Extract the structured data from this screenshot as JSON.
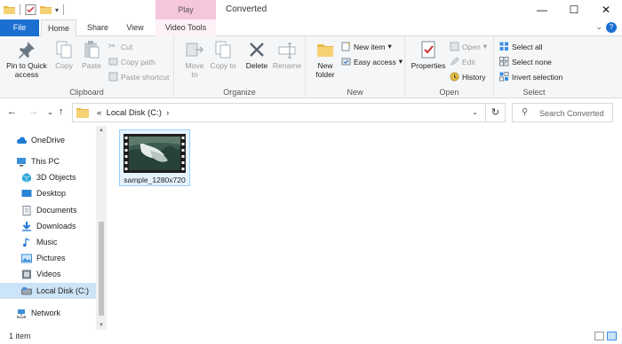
{
  "window": {
    "title": "Converted",
    "contextual_tab_header": "Play",
    "controls": [
      "—",
      "☐",
      "✕"
    ]
  },
  "ribbon_tabs": {
    "file": "File",
    "home": "Home",
    "share": "Share",
    "view": "View",
    "video_tools": "Video Tools"
  },
  "ribbon": {
    "clipboard": {
      "label": "Clipboard",
      "pin": "Pin to Quick access",
      "copy": "Copy",
      "paste": "Paste",
      "cut": "Cut",
      "copy_path": "Copy path",
      "paste_shortcut": "Paste shortcut"
    },
    "organize": {
      "label": "Organize",
      "move_to": "Move to",
      "copy_to": "Copy to",
      "delete": "Delete",
      "rename": "Rename"
    },
    "new": {
      "label": "New",
      "new_folder": "New folder",
      "new_item": "New item",
      "easy_access": "Easy access"
    },
    "open": {
      "label": "Open",
      "properties": "Properties",
      "open": "Open",
      "edit": "Edit",
      "history": "History"
    },
    "select": {
      "label": "Select",
      "select_all": "Select all",
      "select_none": "Select none",
      "invert_selection": "Invert selection"
    }
  },
  "address": {
    "prefix": "«",
    "path": "Local Disk (C:)",
    "separator": "›",
    "search_placeholder": "Search Converted"
  },
  "sidebar": {
    "items": [
      {
        "label": "OneDrive",
        "icon": "cloud-icon",
        "color": "#1f7ad6"
      },
      {
        "label": "This PC",
        "icon": "computer-icon",
        "color": "#3b8fd8"
      },
      {
        "label": "3D Objects",
        "icon": "cube-icon",
        "color": "#2fa7d9"
      },
      {
        "label": "Desktop",
        "icon": "desktop-icon",
        "color": "#2b84d6"
      },
      {
        "label": "Documents",
        "icon": "documents-icon",
        "color": "#7c8894"
      },
      {
        "label": "Downloads",
        "icon": "download-icon",
        "color": "#1f7ad6"
      },
      {
        "label": "Music",
        "icon": "music-icon",
        "color": "#1f7ad6"
      },
      {
        "label": "Pictures",
        "icon": "pictures-icon",
        "color": "#3b8fd8"
      },
      {
        "label": "Videos",
        "icon": "videos-icon",
        "color": "#6f7b86"
      },
      {
        "label": "Local Disk (C:)",
        "icon": "drive-icon",
        "color": "#7e8a96"
      },
      {
        "label": "Network",
        "icon": "network-icon",
        "color": "#3b8fd8"
      }
    ]
  },
  "files": [
    {
      "name": "sample_1280x720",
      "type": "video"
    }
  ],
  "status": {
    "count": "1 item"
  },
  "colors": {
    "accent": "#1a6fd1",
    "selection": "#cce4f7",
    "play_tab": "#f5c6dc"
  }
}
